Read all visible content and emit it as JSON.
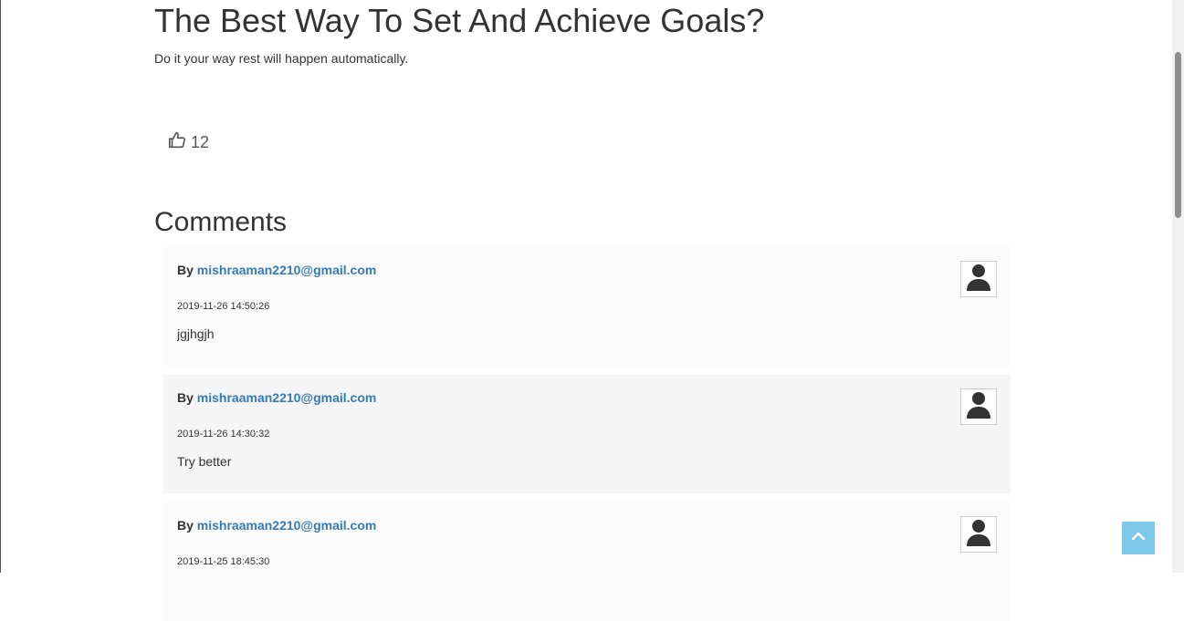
{
  "post": {
    "title": "The Best Way To Set And Achieve Goals?",
    "subtitle": "Do it your way rest will happen automatically.",
    "likes": "12",
    "like_icon": "thumbs-up-icon"
  },
  "comments": {
    "heading": "Comments",
    "by_label": "By",
    "avatar_icon": "user-icon",
    "items": [
      {
        "author": "mishraaman2210@gmail.com",
        "date": "2019-11-26 14:50:26",
        "text": "jgjhgjh"
      },
      {
        "author": "mishraaman2210@gmail.com",
        "date": "2019-11-26 14:30:32",
        "text": "Try better"
      },
      {
        "author": "mishraaman2210@gmail.com",
        "date": "2019-11-25 18:45:30",
        "text": ""
      }
    ]
  },
  "back_to_top_icon": "chevron-up-icon",
  "colors": {
    "link": "#337ab7",
    "back_to_top": "#7ec8ec",
    "card_bg": "#fafafa",
    "card_bg_alt": "#f5f5f5"
  }
}
